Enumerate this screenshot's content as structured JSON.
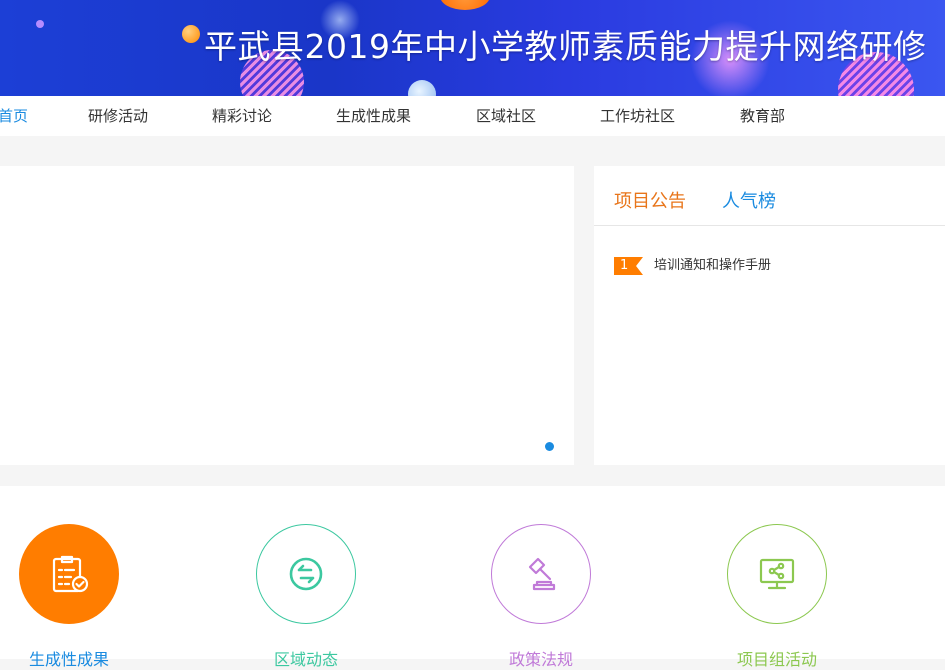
{
  "banner": {
    "title": "平武县2019年中小学教师素质能力提升网络研修"
  },
  "nav": {
    "items": [
      {
        "label": "首页"
      },
      {
        "label": "研修活动"
      },
      {
        "label": "精彩讨论"
      },
      {
        "label": "生成性成果"
      },
      {
        "label": "区域社区"
      },
      {
        "label": "工作坊社区"
      },
      {
        "label": "教育部"
      }
    ],
    "active_color": "#1a8be0"
  },
  "panel": {
    "tabs": [
      {
        "label": "项目公告",
        "color": "#e8751a"
      },
      {
        "label": "人气榜",
        "color": "#1a8be0"
      }
    ],
    "notices": [
      {
        "rank": "1",
        "title": "培训通知和操作手册"
      }
    ]
  },
  "features": [
    {
      "label": "生成性成果",
      "icon": "clipboard-check-icon",
      "color": "#ff7d00"
    },
    {
      "label": "区域动态",
      "icon": "exchange-arrows-icon",
      "color": "#3cc8a0"
    },
    {
      "label": "政策法规",
      "icon": "gavel-icon",
      "color": "#c07ad8"
    },
    {
      "label": "项目组活动",
      "icon": "monitor-share-icon",
      "color": "#8cc850"
    }
  ]
}
